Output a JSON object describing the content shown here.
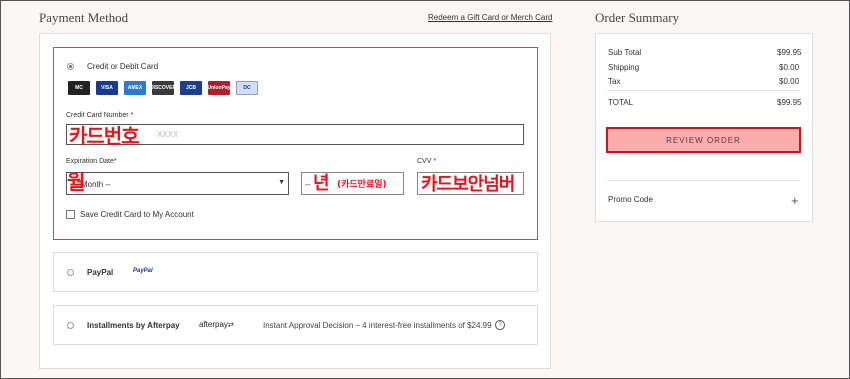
{
  "payment": {
    "title": "Payment Method",
    "gift_link": "Redeem a Gift Card or Merch Card",
    "credit_option": "Credit or Debit Card",
    "card_logos": [
      {
        "name": "mastercard-logo",
        "label": "MC",
        "color": "#222"
      },
      {
        "name": "visa-logo",
        "label": "VISA",
        "color": "#1a3a8f"
      },
      {
        "name": "amex-logo",
        "label": "AMEX",
        "color": "#2b7bd0"
      },
      {
        "name": "discover-logo",
        "label": "DISCOVER",
        "color": "#3a3a3a"
      },
      {
        "name": "jcb-logo",
        "label": "JCB",
        "color": "#1b3f8f"
      },
      {
        "name": "unionpay-logo",
        "label": "UnionPay",
        "color": "#b0202a"
      },
      {
        "name": "diners-logo",
        "label": "DC",
        "color": "#cfe0f0"
      }
    ],
    "card_number_label": "Credit Card Number *",
    "card_number_placeholder": "XXXX",
    "card_number_annotation": "카드번호",
    "expiration_label": "Expiration Date*",
    "month_value": "Month --",
    "month_annotation": "월",
    "year_value": "--",
    "year_annotation_main": "년",
    "year_annotation_sub": "(카드만료일)",
    "cvv_label": "CVV *",
    "cvv_annotation": "카드보안넘버",
    "save_card_label": "Save Credit Card to My Account",
    "paypal_label": "PayPal",
    "paypal_logo": "PayPal",
    "afterpay_label": "Installments by Afterpay",
    "afterpay_logo": "afterpay",
    "afterpay_info": "Instant Approval Decision – 4 interest-free installments of $24.99"
  },
  "summary": {
    "title": "Order Summary",
    "rows": [
      {
        "label": "Sub Total",
        "value": "$99.95"
      },
      {
        "label": "Shipping",
        "value": "$0.00"
      },
      {
        "label": "Tax",
        "value": "$0.00"
      }
    ],
    "total_label": "TOTAL",
    "total_value": "$99.95",
    "review_button": "REVIEW ORDER",
    "promo_label": "Promo Code",
    "promo_toggle": "+"
  }
}
